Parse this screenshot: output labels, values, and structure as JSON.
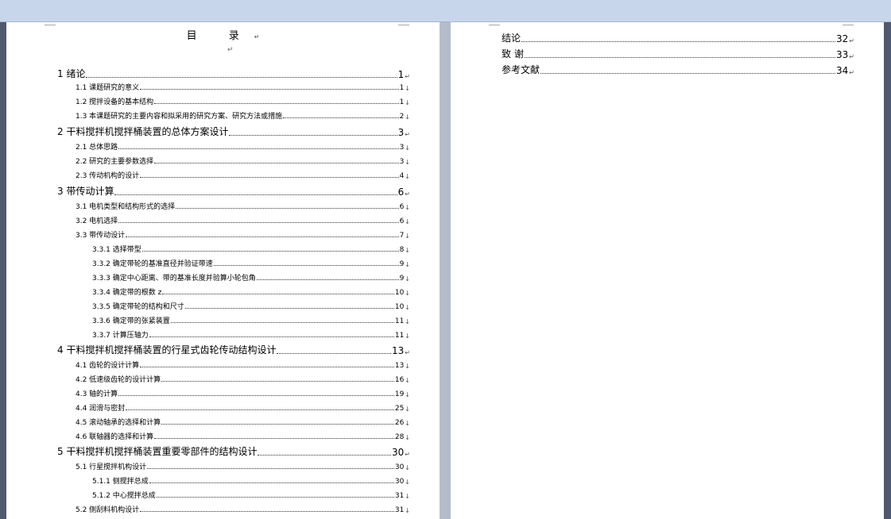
{
  "toc_title": "目  录",
  "page1_entries": [
    {
      "level": 1,
      "text": "1   绪论",
      "page": "1"
    },
    {
      "level": 2,
      "text": "1.1 课题研究的意义",
      "page": "1"
    },
    {
      "level": 2,
      "text": "1.2 搅拌设备的基本结构",
      "page": "1"
    },
    {
      "level": 2,
      "text": "1.3 本课题研究的主要内容和拟采用的研究方案、研究方法或措施",
      "page": "2"
    },
    {
      "level": 1,
      "text": "2 干料搅拌机搅拌桶装置的总体方案设计",
      "page": "3"
    },
    {
      "level": 2,
      "text": "2.1  总体思路",
      "page": "3"
    },
    {
      "level": 2,
      "text": "2.2  研究的主要参数选择",
      "page": "3"
    },
    {
      "level": 2,
      "text": "2.3 传动机构的设计",
      "page": "4"
    },
    {
      "level": 1,
      "text": "3   带传动计算",
      "page": "6"
    },
    {
      "level": 2,
      "text": "3.1 电机类型和结构形式的选择",
      "page": "6"
    },
    {
      "level": 2,
      "text": "3.2 电机选择",
      "page": "6"
    },
    {
      "level": 2,
      "text": "3.3  带传动设计",
      "page": "7"
    },
    {
      "level": 3,
      "text": "3.3.1  选择带型",
      "page": "8"
    },
    {
      "level": 3,
      "text": "3.3.2  确定带轮的基准直径并验证带速",
      "page": "9"
    },
    {
      "level": 3,
      "text": "3.3.3  确定中心距离、带的基准长度并验算小轮包角",
      "page": "9"
    },
    {
      "level": 3,
      "text": "3.3.4  确定带的根数 z",
      "page": "10"
    },
    {
      "level": 3,
      "text": "3.3.5  确定带轮的结构和尺寸",
      "page": "10"
    },
    {
      "level": 3,
      "text": "3.3.6  确定带的张紧装置",
      "page": "11"
    },
    {
      "level": 3,
      "text": "3.3.7  计算压轴力",
      "page": "11"
    },
    {
      "level": 1,
      "text": "4   干料搅拌机搅拌桶装置的行星式齿轮传动结构设计",
      "page": "13"
    },
    {
      "level": 2,
      "text": "4.1 齿轮的设计计算",
      "page": "13"
    },
    {
      "level": 2,
      "text": "4.2 低速级齿轮的设计计算",
      "page": "16"
    },
    {
      "level": 2,
      "text": "4.3  轴的计算",
      "page": "19"
    },
    {
      "level": 2,
      "text": "4.4 润滑与密封",
      "page": "25"
    },
    {
      "level": 2,
      "text": "4.5 滚动轴承的选择和计算",
      "page": "26"
    },
    {
      "level": 2,
      "text": "4.6 联轴器的选择和计算",
      "page": "28"
    },
    {
      "level": 1,
      "text": "5 干料搅拌机搅拌桶装置重要零部件的结构设计",
      "page": "30"
    },
    {
      "level": 2,
      "text": "5.1  行星搅拌机构设计",
      "page": "30"
    },
    {
      "level": 3,
      "text": "5.1.1  侧搅拌总成",
      "page": "30"
    },
    {
      "level": 3,
      "text": "5.1.2  中心搅拌总成",
      "page": "31"
    },
    {
      "level": 2,
      "text": "5.2  侧刮料机构设计",
      "page": "31"
    }
  ],
  "page2_entries": [
    {
      "level": 1,
      "text": "结论",
      "page": "32"
    },
    {
      "level": 1,
      "text": "致  谢",
      "page": "33"
    },
    {
      "level": 1,
      "text": "参考文献",
      "page": "34"
    }
  ],
  "marks": {
    "level1": "↵",
    "level2": "↓",
    "para": "↵"
  }
}
